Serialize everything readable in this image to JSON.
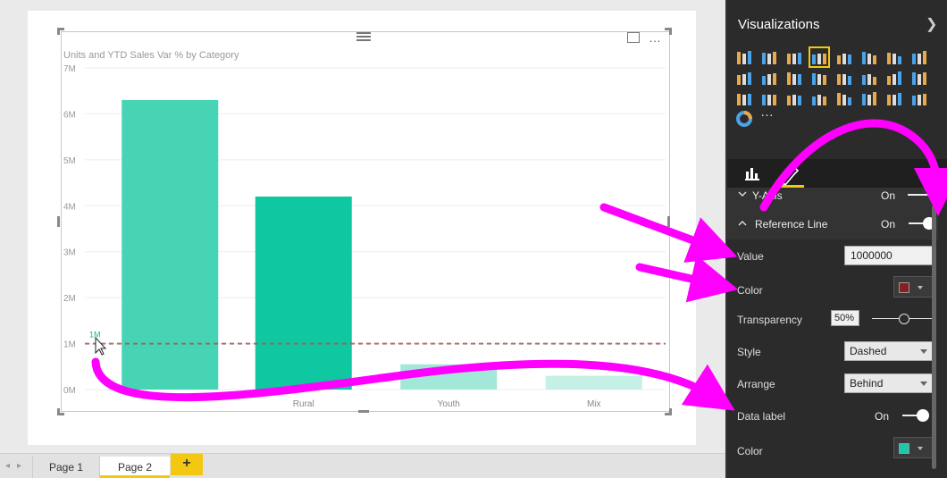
{
  "canvas": {
    "chart_title": "Units and YTD Sales Var % by Category",
    "focus_icon": "focus-mode-icon",
    "more_icon": "more-options-icon",
    "more_text": "…",
    "ref_line_label": "1M"
  },
  "chart_data": {
    "type": "bar",
    "categories": [
      "",
      "Rural",
      "Youth",
      "Mix"
    ],
    "values": [
      6300000,
      4200000,
      550000,
      300000
    ],
    "yticks": [
      "0M",
      "1M",
      "2M",
      "3M",
      "4M",
      "5M",
      "6M",
      "7M"
    ],
    "ylim": [
      0,
      7000000
    ],
    "reference_line": {
      "value": 1000000,
      "label": "1M",
      "style": "dashed",
      "color": "#a05a5a"
    },
    "bar_colors": [
      "#47d4b5",
      "#0fc7a0",
      "#a2e8d8",
      "#c4f0e6"
    ],
    "grid": true,
    "title": "Units and YTD Sales Var % by Category",
    "xlabel": "",
    "ylabel": ""
  },
  "tabs": {
    "prev_label": "◂",
    "next_label": "▸",
    "page1": "Page 1",
    "page2": "Page 2",
    "add": "+"
  },
  "pane": {
    "title": "Visualizations",
    "chevron": "❯",
    "fields_tab_icon": "fields-icon",
    "format_tab_icon": "paint-roller-icon",
    "viz_more": "…",
    "y_axis": {
      "label": "Y-Axis",
      "state": "On"
    },
    "reference_line": {
      "label": "Reference Line",
      "state": "On"
    },
    "value": {
      "label": "Value",
      "text": "1000000"
    },
    "color": {
      "label": "Color",
      "swatch": "#8a1f1f"
    },
    "transparency": {
      "label": "Transparency",
      "value": "50",
      "percent_sign": "%",
      "level": 0.5
    },
    "style": {
      "label": "Style",
      "selected": "Dashed"
    },
    "arrange": {
      "label": "Arrange",
      "selected": "Behind"
    },
    "data_label": {
      "label": "Data label",
      "state": "On"
    },
    "data_label_color": {
      "label": "Color",
      "swatch": "#1fc7a8"
    }
  },
  "accent_colors": {
    "annotation": "#ff00ff",
    "selection": "#f2c811"
  }
}
